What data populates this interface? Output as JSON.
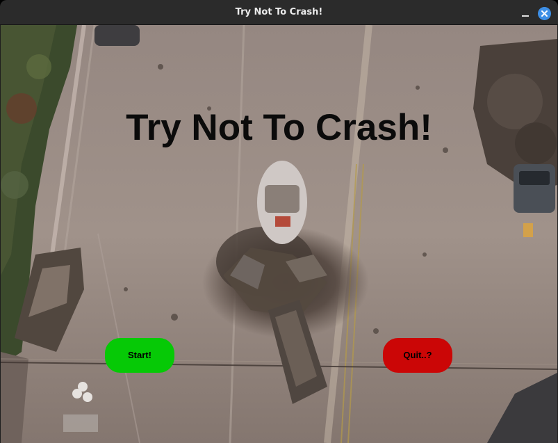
{
  "window": {
    "title": "Try Not To Crash!",
    "minimize_icon": "minimize-icon",
    "close_icon": "close-icon",
    "accent_color": "#3d8fe6"
  },
  "menu": {
    "title": "Try Not To Crash!",
    "start_label": "Start!",
    "quit_label": "Quit..?",
    "start_color": "#06c906",
    "quit_color": "#cb0606"
  }
}
